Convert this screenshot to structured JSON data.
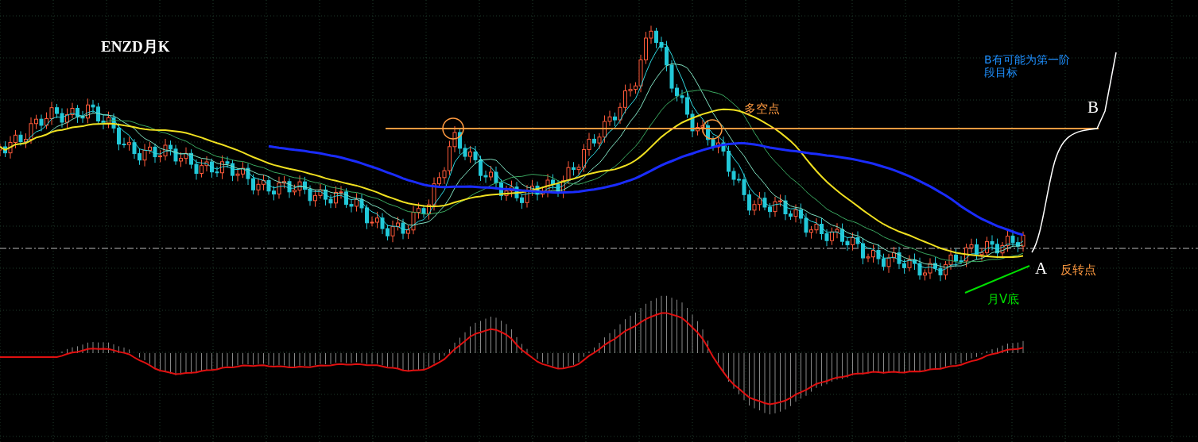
{
  "chart_title": "ENZD月K",
  "target_note": {
    "lines": [
      "B有可能为第一阶",
      "段目标"
    ]
  },
  "resistance_label": "多空点",
  "point_b": "B",
  "point_a": "A",
  "reversal_label": "反转点",
  "v_bottom_label": "月V底"
}
